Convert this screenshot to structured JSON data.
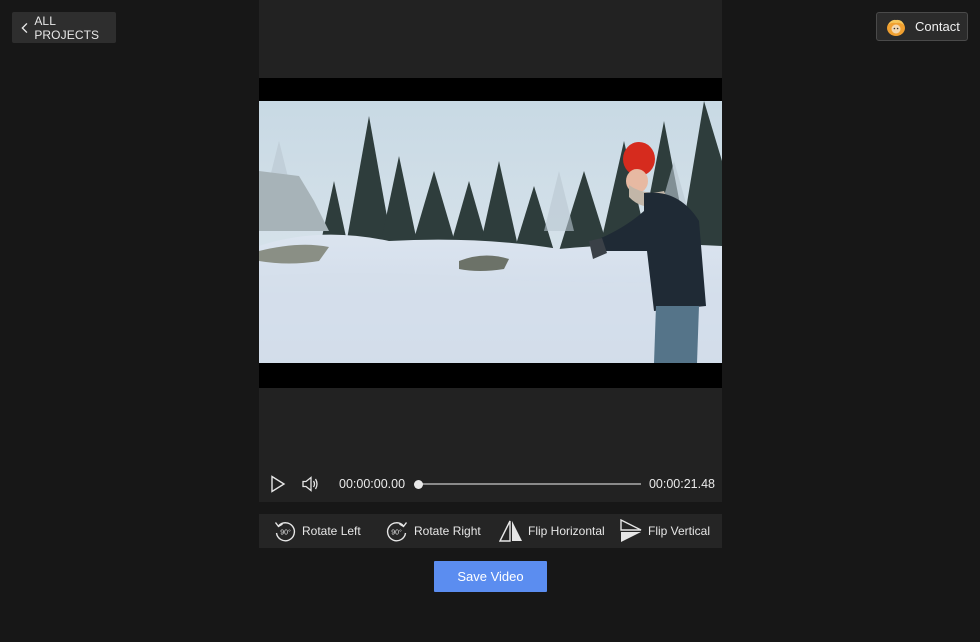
{
  "nav": {
    "back_label": "ALL PROJECTS",
    "contact_label": "Contact"
  },
  "player": {
    "current_time": "00:00:00.00",
    "total_time": "00:00:21.48",
    "progress": 0.0
  },
  "tools": {
    "rotate_left": "Rotate Left",
    "rotate_right": "Rotate Right",
    "flip_horizontal": "Flip Horizontal",
    "flip_vertical": "Flip Vertical",
    "rotate_badge": "90°"
  },
  "actions": {
    "save_label": "Save Video"
  },
  "colors": {
    "accent": "#5b8df0",
    "background": "#171717",
    "panel": "#222222"
  }
}
